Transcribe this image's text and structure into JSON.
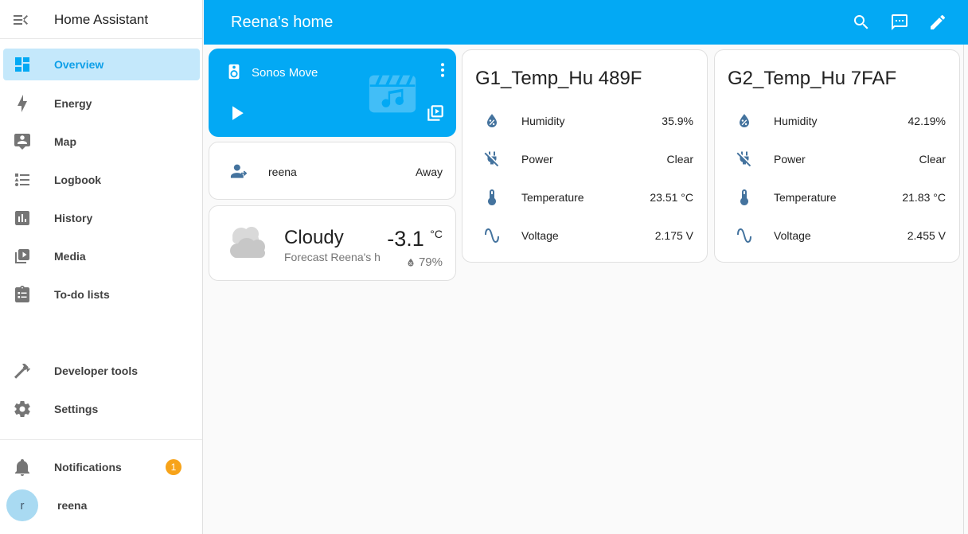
{
  "app": {
    "name": "Home Assistant"
  },
  "header": {
    "title": "Reena's home",
    "icons": [
      "search-icon",
      "assist-chat-icon",
      "edit-pencil-icon"
    ]
  },
  "sidebar": {
    "items": [
      {
        "label": "Overview",
        "icon": "view-dashboard-icon",
        "selected": true
      },
      {
        "label": "Energy",
        "icon": "lightning-bolt-icon",
        "selected": false
      },
      {
        "label": "Map",
        "icon": "tooltip-account-icon",
        "selected": false
      },
      {
        "label": "Logbook",
        "icon": "bulleted-list-icon",
        "selected": false
      },
      {
        "label": "History",
        "icon": "chart-box-icon",
        "selected": false
      },
      {
        "label": "Media",
        "icon": "play-box-multiple-icon",
        "selected": false
      },
      {
        "label": "To-do lists",
        "icon": "clipboard-list-icon",
        "selected": false
      }
    ],
    "tools": [
      {
        "label": "Developer tools",
        "icon": "hammer-icon"
      },
      {
        "label": "Settings",
        "icon": "cog-icon"
      }
    ],
    "notifications": {
      "label": "Notifications",
      "badge": "1",
      "icon": "bell-icon"
    },
    "user": {
      "name": "reena",
      "avatar_letter": "r"
    }
  },
  "cards": {
    "media": {
      "name": "Sonos Move",
      "icons": [
        "speaker-icon",
        "dots-vertical-icon",
        "movie-music-icon",
        "play-icon",
        "browse-media-icon"
      ]
    },
    "person": {
      "name": "reena",
      "state": "Away",
      "icon": "account-arrow-right-icon"
    },
    "weather": {
      "condition": "Cloudy",
      "secondary": "Forecast Reena's h…",
      "temperature": "-3.1",
      "temperature_unit": "°C",
      "humidity": "79%",
      "icon": "cloudy-icon"
    },
    "sensors": [
      {
        "title": "G1_Temp_Hu 489F",
        "rows": [
          {
            "label": "Humidity",
            "value": "35.9%",
            "icon": "water-percent-icon"
          },
          {
            "label": "Power",
            "value": "Clear",
            "icon": "power-plug-off-icon"
          },
          {
            "label": "Temperature",
            "value": "23.51 °C",
            "icon": "thermometer-icon"
          },
          {
            "label": "Voltage",
            "value": "2.175 V",
            "icon": "sine-wave-icon"
          }
        ]
      },
      {
        "title": "G2_Temp_Hu 7FAF",
        "rows": [
          {
            "label": "Humidity",
            "value": "42.19%",
            "icon": "water-percent-icon"
          },
          {
            "label": "Power",
            "value": "Clear",
            "icon": "power-plug-off-icon"
          },
          {
            "label": "Temperature",
            "value": "21.83 °C",
            "icon": "thermometer-icon"
          },
          {
            "label": "Voltage",
            "value": "2.455 V",
            "icon": "sine-wave-icon"
          }
        ]
      }
    ]
  },
  "colors": {
    "primary": "#03a9f4",
    "badge": "#f7a319",
    "sensor_icon": "#44739e",
    "selected_item_bg": "#c4e8fb",
    "content_bg": "#fafafa"
  }
}
